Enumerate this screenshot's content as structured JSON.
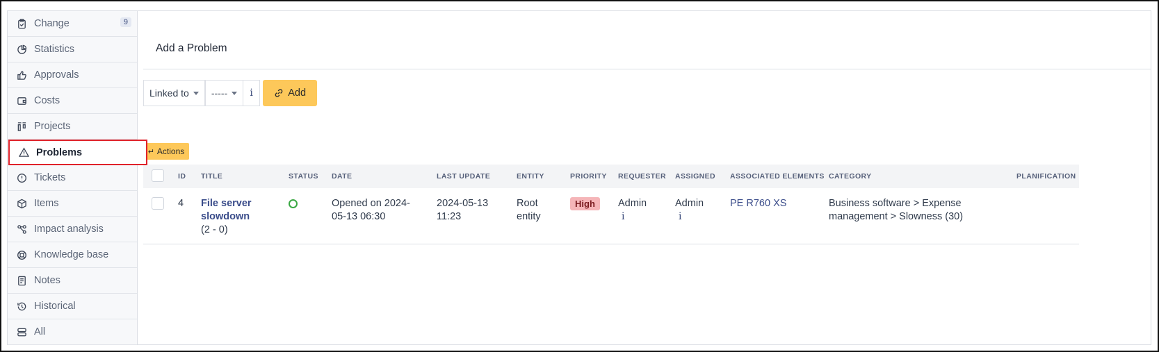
{
  "sidebar": {
    "items": [
      {
        "label": "Change",
        "icon": "clipboard-check-icon",
        "count": "9"
      },
      {
        "label": "Statistics",
        "icon": "pie-chart-icon"
      },
      {
        "label": "Approvals",
        "icon": "thumbs-up-icon"
      },
      {
        "label": "Costs",
        "icon": "wallet-icon"
      },
      {
        "label": "Projects",
        "icon": "project-columns-icon"
      },
      {
        "label": "Problems",
        "icon": "warning-triangle-icon",
        "active": true
      },
      {
        "label": "Tickets",
        "icon": "alert-circle-icon"
      },
      {
        "label": "Items",
        "icon": "cube-icon"
      },
      {
        "label": "Impact analysis",
        "icon": "network-nodes-icon"
      },
      {
        "label": "Knowledge base",
        "icon": "lifebuoy-icon"
      },
      {
        "label": "Notes",
        "icon": "note-icon"
      },
      {
        "label": "Historical",
        "icon": "history-icon"
      },
      {
        "label": "All",
        "icon": "stack-icon"
      }
    ]
  },
  "main": {
    "section_title": "Add a Problem",
    "toolbar": {
      "linked_to": "Linked to",
      "item_select": "-----",
      "info": "i",
      "add_label": "Add"
    },
    "actions_label": "Actions",
    "table": {
      "headers": [
        "ID",
        "TITLE",
        "STATUS",
        "DATE",
        "LAST UPDATE",
        "ENTITY",
        "PRIORITY",
        "REQUESTER",
        "ASSIGNED",
        "ASSOCIATED ELEMENTS",
        "CATEGORY",
        "PLANIFICATION"
      ],
      "row": {
        "id": "4",
        "title": "File server slowdown",
        "title_counts": "(2 - 0)",
        "status_color": "#3aa843",
        "date": "Opened on 2024-05-13 06:30",
        "last_update": "2024-05-13 11:23",
        "entity": "Root entity",
        "priority": "High",
        "requester": "Admin",
        "assigned": "Admin",
        "associated": "PE R760 XS",
        "category": "Business software > Expense management > Slowness (30)",
        "planification": ""
      }
    }
  },
  "colors": {
    "accent": "#fdc85a",
    "active_border": "#e0222a",
    "link": "#3a4c8a",
    "priority_high_bg": "#f5b5b8"
  }
}
